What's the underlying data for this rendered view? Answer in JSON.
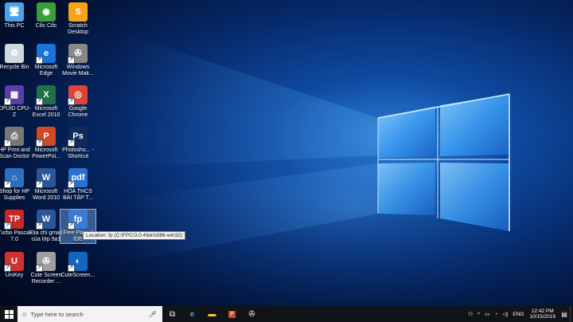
{
  "desktop": {
    "icons": [
      {
        "label": "This PC",
        "icon": "computer-icon",
        "color": "#4aa3e8"
      },
      {
        "label": "Cốc Cốc",
        "icon": "coccoc-icon",
        "color": "#3b9e3b"
      },
      {
        "label": "Scratch Desktop",
        "icon": "scratch-icon",
        "color": "#f7a21b"
      },
      {
        "label": "Recycle Bin",
        "icon": "recycle-bin-icon",
        "color": "#cfd8dc"
      },
      {
        "label": "Microsoft Edge",
        "icon": "edge-icon",
        "color": "#1a73d9"
      },
      {
        "label": "Windows Movie Mak...",
        "icon": "film-reel-icon",
        "color": "#888888"
      },
      {
        "label": "CPUID CPU-Z",
        "icon": "cpu-icon",
        "color": "#5c3da8"
      },
      {
        "label": "Microsoft Excel 2010",
        "icon": "excel-icon",
        "color": "#1e7145"
      },
      {
        "label": "Google Chrome",
        "icon": "chrome-icon",
        "color": "#db4437"
      },
      {
        "label": "HP Print and Scan Doctor",
        "icon": "printer-icon",
        "color": "#777777"
      },
      {
        "label": "Microsoft PowerPoi...",
        "icon": "powerpoint-icon",
        "color": "#d24726"
      },
      {
        "label": "Photosho... - Shortcut",
        "icon": "photoshop-icon",
        "color": "#0f2b5b"
      },
      {
        "label": "Shop for HP Supplies",
        "icon": "shopping-icon",
        "color": "#2c6fbf"
      },
      {
        "label": "Microsoft Word 2010",
        "icon": "word-icon",
        "color": "#2b579a"
      },
      {
        "label": "HOA THCS BÀI TẬP T...",
        "icon": "pdf-icon",
        "color": "#2a6fd1"
      },
      {
        "label": "Turbo Pascal 7.0",
        "icon": "turbo-pascal-icon",
        "color": "#c62828"
      },
      {
        "label": "Địa chỉ gmail của lớp 9a1",
        "icon": "document-icon",
        "color": "#2b579a"
      },
      {
        "label": "Free Pascal IDE",
        "icon": "free-pascal-icon",
        "color": "#3a7bd5"
      },
      {
        "label": "UniKey",
        "icon": "unikey-icon",
        "color": "#d32f2f"
      },
      {
        "label": "Cute Screen Recorder ...",
        "icon": "cute-recorder-icon",
        "color": "#9e9e9e"
      },
      {
        "label": "CuteScreen...",
        "icon": "cutescreen-icon",
        "color": "#1565c0"
      }
    ],
    "tooltip": "Location: fp (C:\\FPC\\3.0.4\\bin\\i386-win32)"
  },
  "taskbar": {
    "search_placeholder": "Type here to search",
    "apps": [
      "task-view-icon",
      "edge-icon",
      "file-explorer-icon",
      "powerpoint-icon",
      "movie-maker-icon"
    ],
    "tray": {
      "language": "ENG",
      "time": "12:42 PM",
      "date": "10/15/2019"
    }
  }
}
